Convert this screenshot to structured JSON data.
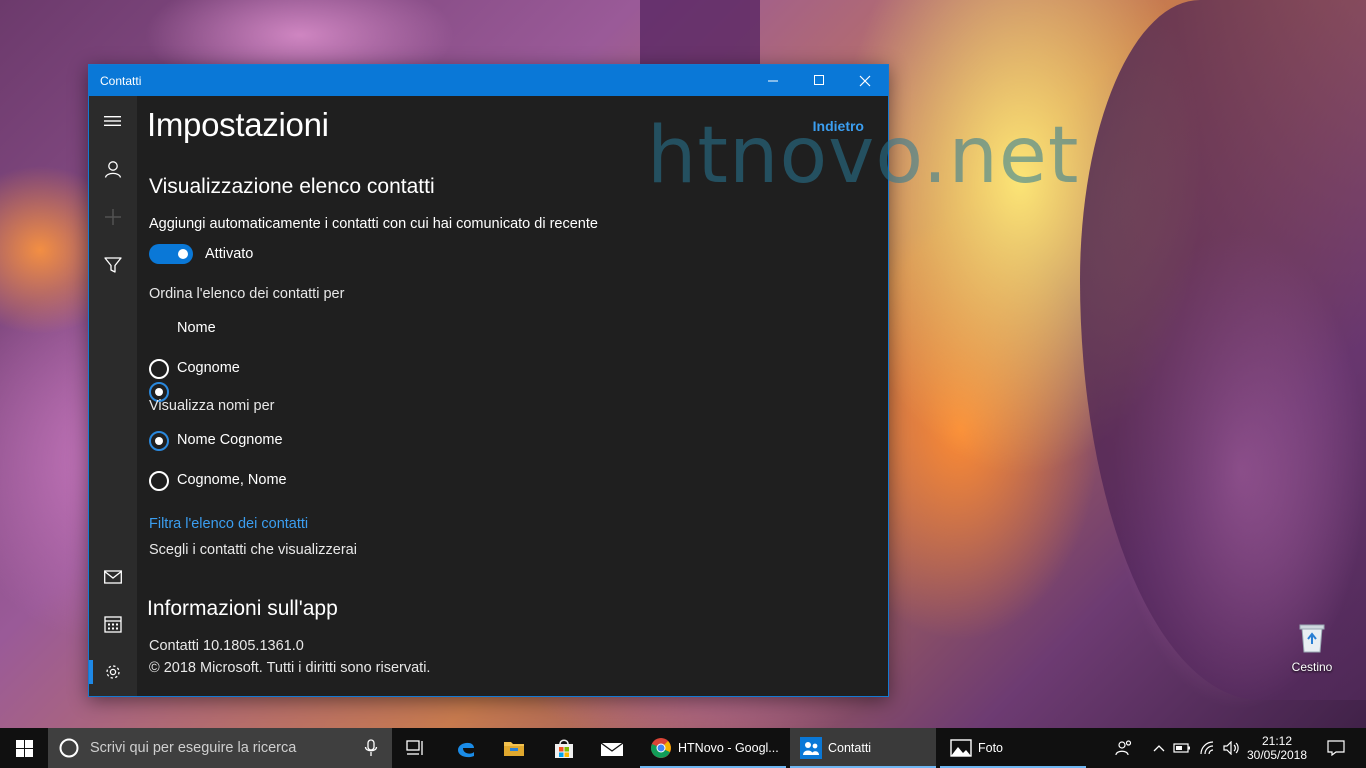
{
  "window": {
    "title": "Contatti",
    "controls": [
      "minimize",
      "maximize",
      "close"
    ]
  },
  "sidebar": {
    "items": [
      {
        "name": "hamburger-menu",
        "icon": "menu-icon"
      },
      {
        "name": "contacts",
        "icon": "person-icon"
      },
      {
        "name": "add",
        "icon": "plus-icon"
      },
      {
        "name": "filter",
        "icon": "filter-icon"
      },
      {
        "name": "mail",
        "icon": "mail-icon"
      },
      {
        "name": "calendar",
        "icon": "calendar-icon"
      },
      {
        "name": "settings",
        "icon": "gear-icon",
        "active": true
      }
    ]
  },
  "page": {
    "title": "Impostazioni",
    "back_link": "Indietro",
    "watermark": "htnovo.net"
  },
  "list_display": {
    "section_title": "Visualizzazione elenco contatti",
    "auto_add_label": "Aggiungi automaticamente i contatti con cui hai comunicato di recente",
    "auto_add_state": "Attivato",
    "auto_add_on": true,
    "sort_label": "Ordina l'elenco dei contatti per",
    "sort_options": [
      {
        "label": "Nome",
        "checked": true
      },
      {
        "label": "Cognome",
        "checked": false
      }
    ],
    "names_label": "Visualizza nomi per",
    "names_options": [
      {
        "label": "Nome Cognome",
        "checked": true
      },
      {
        "label": "Cognome, Nome",
        "checked": false
      }
    ],
    "filter_link": "Filtra l'elenco dei contatti",
    "filter_desc": "Scegli i contatti che visualizzerai"
  },
  "about": {
    "section_title": "Informazioni sull'app",
    "version": "Contatti 10.1805.1361.0",
    "copyright": "© 2018 Microsoft. Tutti i diritti sono riservati."
  },
  "desktop": {
    "recycle_bin_label": "Cestino"
  },
  "taskbar": {
    "search_placeholder": "Scrivi qui per eseguire la ricerca",
    "apps": [
      {
        "label": "HTNovo - Googl...",
        "icon": "chrome-icon",
        "active": false
      },
      {
        "label": "Contatti",
        "icon": "people-icon",
        "active": true
      },
      {
        "label": "Foto",
        "icon": "photos-icon",
        "active": false
      }
    ],
    "time": "21:12",
    "date": "30/05/2018",
    "accent": "#0a78d7"
  }
}
